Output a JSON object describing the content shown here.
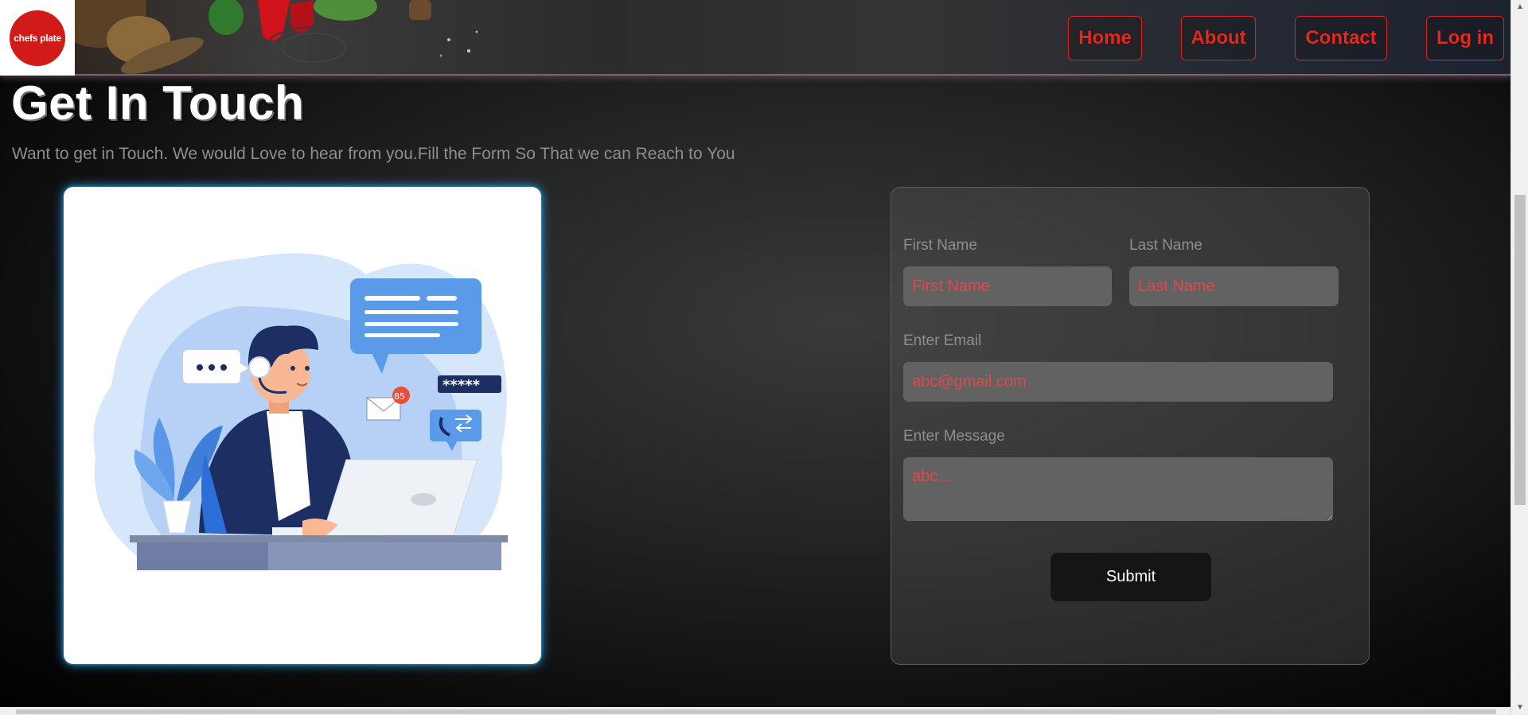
{
  "header": {
    "logo_text": "chefs plate",
    "nav": [
      {
        "label": "Home"
      },
      {
        "label": "About"
      },
      {
        "label": "Contact"
      },
      {
        "label": "Log in"
      }
    ]
  },
  "main": {
    "title": "Get In Touch",
    "subtitle": "Want to get in Touch. We would Love to hear from you.Fill the Form So That we can Reach to You"
  },
  "illustration": {
    "badge_count": "85",
    "password_mask": "*****"
  },
  "form": {
    "first_name_label": "First Name",
    "first_name_placeholder": "First Name",
    "last_name_label": "Last Name",
    "last_name_placeholder": "Last Name",
    "email_label": "Enter Email",
    "email_placeholder": "abc@gmail.com",
    "message_label": "Enter Message",
    "message_placeholder": "abc...",
    "submit_label": "Submit"
  },
  "colors": {
    "accent_red": "#e22a20",
    "card_glow": "#28a0e6",
    "placeholder_red": "#e0484c"
  },
  "icons": [
    "logo-icon",
    "chevron-up-icon",
    "chevron-down-icon"
  ]
}
